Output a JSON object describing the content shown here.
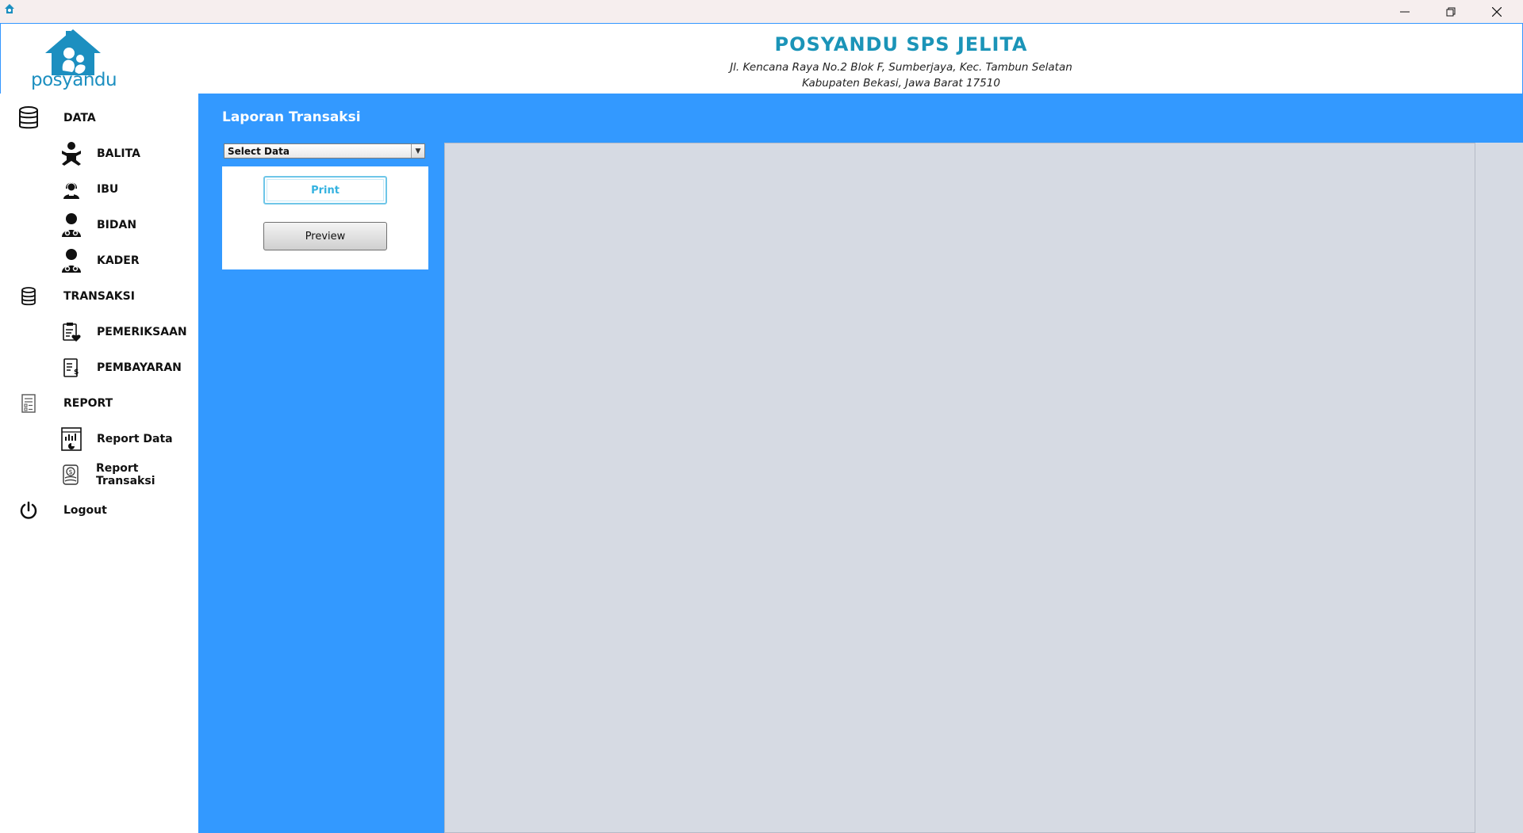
{
  "window": {
    "minimize_icon": "minimize-icon",
    "restore_icon": "restore-icon",
    "close_icon": "close-icon"
  },
  "header": {
    "logo_text": "posyandu",
    "title": "POSYANDU SPS JELITA",
    "address_line1": "Jl. Kencana Raya No.2 Blok F, Sumberjaya, Kec. Tambun Selatan",
    "address_line2": "Kabupaten Bekasi, Jawa Barat 17510"
  },
  "sidebar": {
    "items": [
      {
        "label": "DATA",
        "icon": "database-icon"
      },
      {
        "label": "BALITA",
        "icon": "baby-icon"
      },
      {
        "label": "IBU",
        "icon": "mother-icon"
      },
      {
        "label": "BIDAN",
        "icon": "midwife-icon"
      },
      {
        "label": "KADER",
        "icon": "cadre-icon"
      },
      {
        "label": "TRANSAKSI",
        "icon": "database-icon"
      },
      {
        "label": "PEMERIKSAAN",
        "icon": "checkup-clipboard-icon"
      },
      {
        "label": "PEMBAYARAN",
        "icon": "payment-document-icon"
      },
      {
        "label": "REPORT",
        "icon": "report-list-icon"
      },
      {
        "label": "Report Data",
        "icon": "report-chart-icon"
      },
      {
        "label": "Report Transaksi",
        "icon": "report-money-icon"
      },
      {
        "label": "Logout",
        "icon": "power-icon"
      }
    ]
  },
  "main": {
    "title": "Laporan Transaksi",
    "select": {
      "value": "Select Data"
    },
    "print_label": "Print",
    "preview_label": "Preview"
  },
  "colors": {
    "main_bg": "#3399ff",
    "title_color": "#1b94b8",
    "preview_bg": "#d6dae3"
  }
}
